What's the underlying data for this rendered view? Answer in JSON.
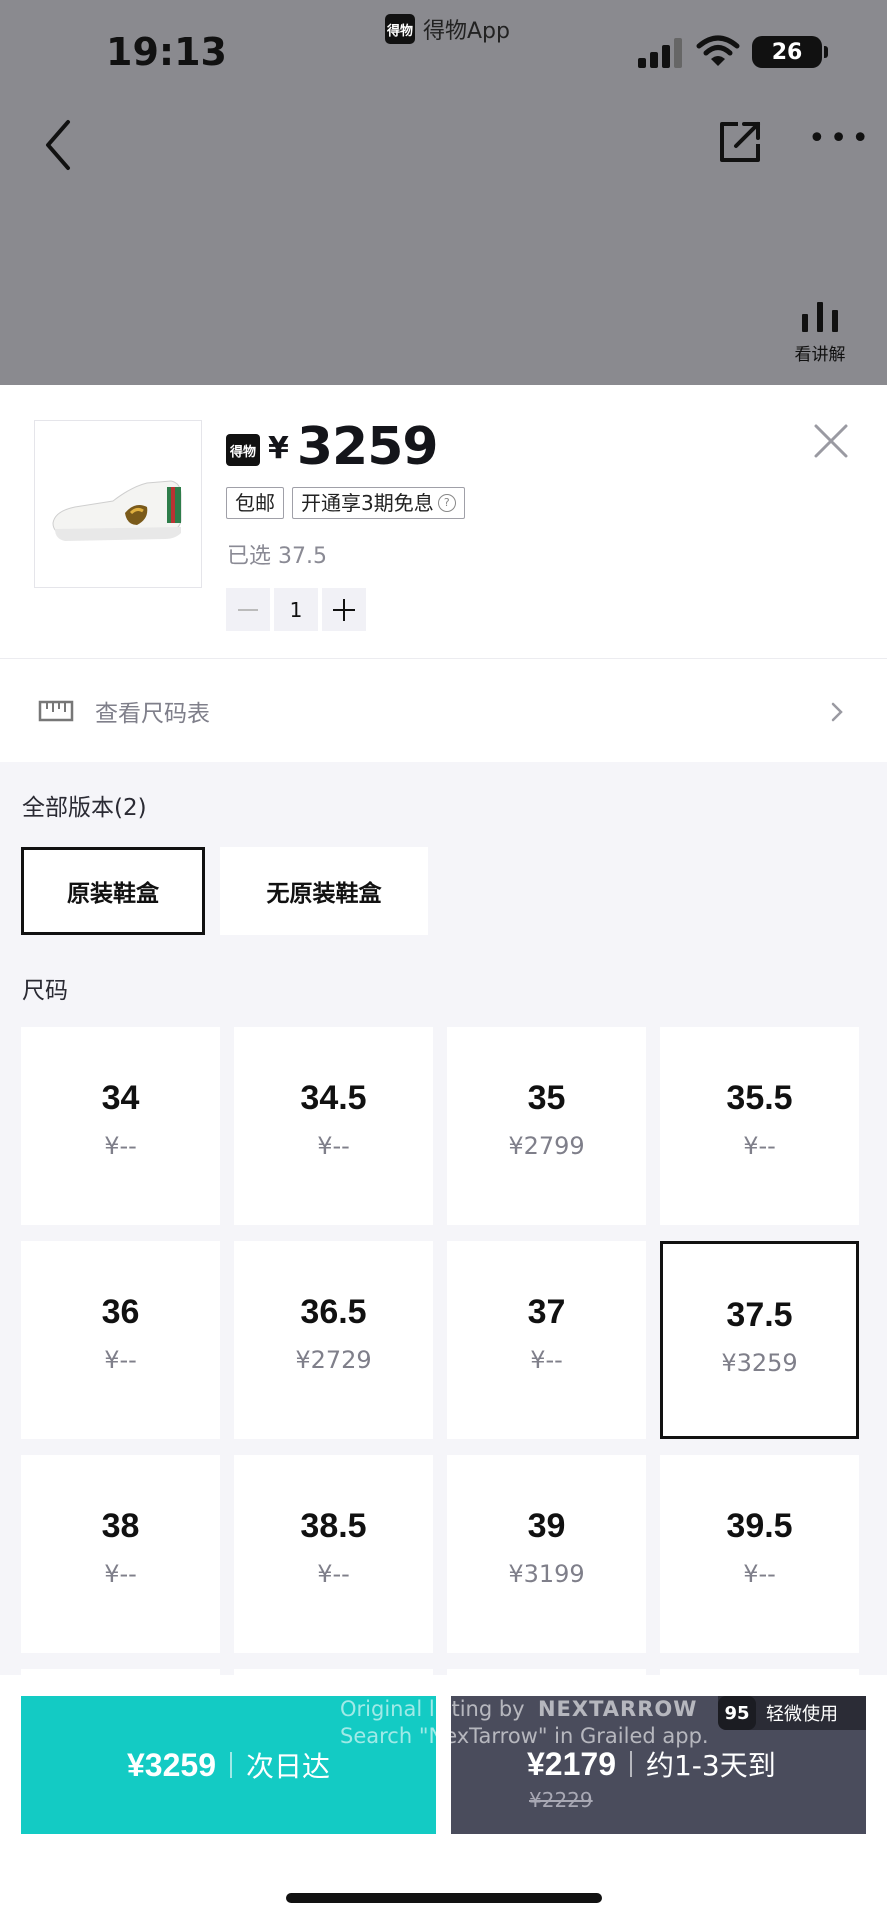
{
  "status_bar": {
    "time": "19:13",
    "app_badge": "得物",
    "app_name": "得物App",
    "battery": "26"
  },
  "nav": {
    "explain_label": "看讲解"
  },
  "product": {
    "badge": "得物",
    "currency": "¥",
    "price": "3259",
    "tags": [
      "包邮",
      "开通享3期免息"
    ],
    "selected_text": "已选 37.5",
    "quantity": "1"
  },
  "size_chart": {
    "label": "查看尺码表"
  },
  "versions": {
    "label": "全部版本(2)",
    "items": [
      "原装鞋盒",
      "无原装鞋盒"
    ],
    "selected": "原装鞋盒"
  },
  "sizes": {
    "label": "尺码",
    "selected": "37.5",
    "items": [
      {
        "size": "34",
        "price": "¥--"
      },
      {
        "size": "34.5",
        "price": "¥--"
      },
      {
        "size": "35",
        "price": "¥2799"
      },
      {
        "size": "35.5",
        "price": "¥--"
      },
      {
        "size": "36",
        "price": "¥--"
      },
      {
        "size": "36.5",
        "price": "¥2729"
      },
      {
        "size": "37",
        "price": "¥--"
      },
      {
        "size": "37.5",
        "price": "¥3259"
      },
      {
        "size": "38",
        "price": "¥--"
      },
      {
        "size": "38.5",
        "price": "¥--"
      },
      {
        "size": "39",
        "price": "¥3199"
      },
      {
        "size": "39.5",
        "price": "¥--"
      }
    ]
  },
  "buy_fast": {
    "price": "¥3259",
    "label": "次日达"
  },
  "buy_used": {
    "price": "¥2179",
    "label": "约1-3天到",
    "original_price": "¥2229",
    "condition_score": "95",
    "condition_label": "轻微使用"
  },
  "watermark": {
    "line1_prefix": "Original listing by",
    "brand": "NEXTARROW",
    "line2": "Search \"NexTarrow\" in Grailed app."
  },
  "colors": {
    "accent": "#13cbc4",
    "dark_button": "#4a4c5c",
    "overlay": "#8a8a8f"
  }
}
